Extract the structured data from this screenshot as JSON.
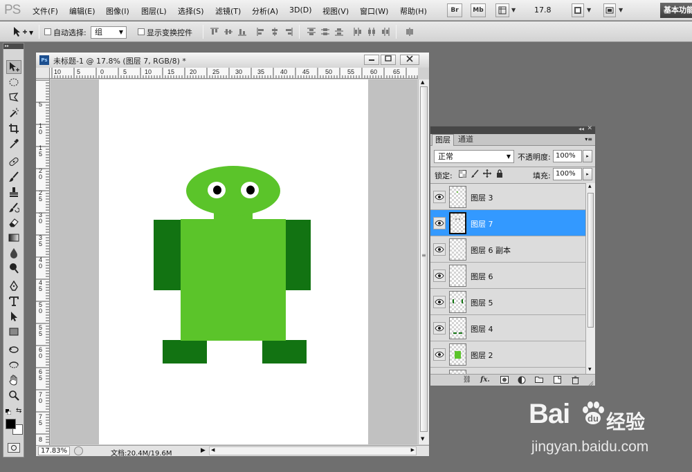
{
  "app": {
    "logo": "PS",
    "menu": [
      "文件(F)",
      "编辑(E)",
      "图像(I)",
      "图层(L)",
      "选择(S)",
      "滤镜(T)",
      "分析(A)",
      "3D(D)",
      "视图(V)",
      "窗口(W)",
      "帮助(H)"
    ],
    "bridge_btn": "Br",
    "minibridge_btn": "Mb",
    "zoom_level": "17.8",
    "workspace": "基本功能"
  },
  "options": {
    "auto_select_label": "自动选择:",
    "auto_select_value": "组",
    "show_transform_label": "显示变换控件"
  },
  "document": {
    "ps_icon": "Ps",
    "title": "未标题-1 @ 17.8% (图层 7, RGB/8) *",
    "ruler_top": [
      "10",
      "5",
      "0",
      "5",
      "10",
      "15",
      "20",
      "25",
      "30",
      "35",
      "40",
      "45",
      "50",
      "55",
      "60",
      "65"
    ],
    "ruler_left": [
      "5",
      "1 0",
      "1 5",
      "2 0",
      "2 5",
      "3 0",
      "3 5",
      "4 0",
      "4 5",
      "5 0",
      "5 5",
      "6 0",
      "6 5",
      "7 0",
      "7 5",
      "8"
    ],
    "zoom_status": "17.83%",
    "doc_info": "文档:20.4M/19.6M"
  },
  "artwork": {
    "head_color": "#5bc42a",
    "body_color": "#5bc42a",
    "limb_color": "#127312",
    "eye_white": "#ffffff",
    "eye_pupil": "#000000"
  },
  "layers_panel": {
    "tabs": [
      "图层",
      "通道"
    ],
    "blend_mode": "正常",
    "opacity_label": "不透明度:",
    "opacity_value": "100%",
    "lock_label": "锁定:",
    "fill_label": "填充:",
    "fill_value": "100%",
    "layers": [
      {
        "name": "图层 3",
        "selected": false
      },
      {
        "name": "图层 7",
        "selected": true
      },
      {
        "name": "图层 6 副本",
        "selected": false
      },
      {
        "name": "图层 6",
        "selected": false
      },
      {
        "name": "图层 5",
        "selected": false
      },
      {
        "name": "图层 4",
        "selected": false
      },
      {
        "name": "图层 2",
        "selected": false
      }
    ]
  },
  "watermark": {
    "brand": "Bai",
    "brand_suffix": "du",
    "jingyan": "经验",
    "url": "jingyan.baidu.com"
  }
}
